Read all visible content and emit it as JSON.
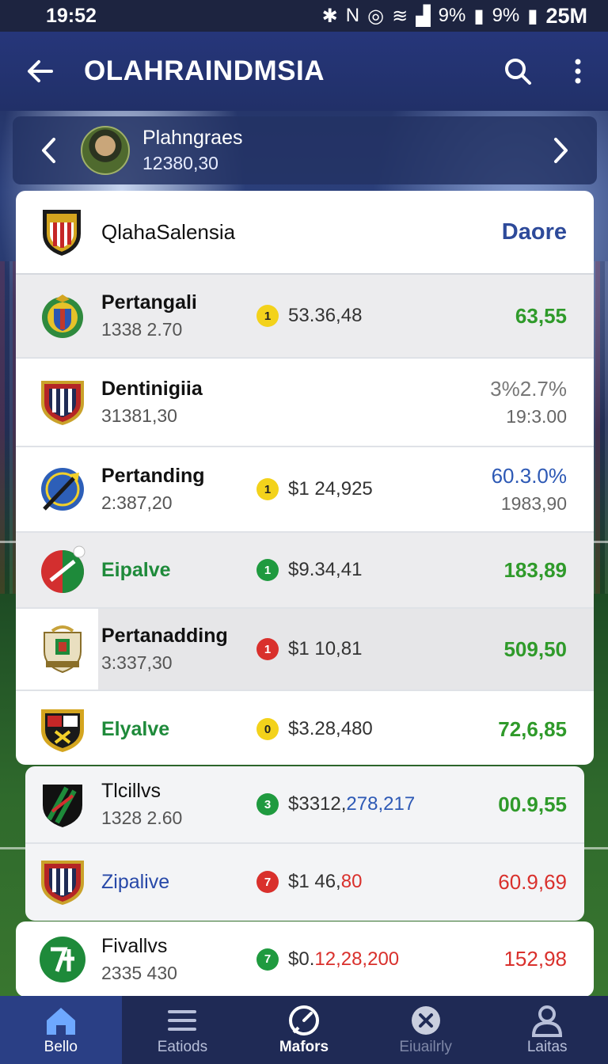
{
  "status": {
    "time": "19:52",
    "battery1": "9%",
    "battery2": "9%",
    "extra": "25M"
  },
  "appbar": {
    "title": "OLAHRAINDMSIA"
  },
  "player": {
    "name": "Plahngraes",
    "value": "12380,30"
  },
  "club": {
    "name": "QlahaSalensia",
    "more_label": "Daore"
  },
  "rows": [
    {
      "name": "Pertangali",
      "sub": "1338 2.70",
      "badge": "1",
      "amount": "53.36,48",
      "right1": "63,55",
      "right2": ""
    },
    {
      "name": "Dentinigiia",
      "sub": "31381,30",
      "badge": "",
      "amount": "",
      "right1": "3%2.7%",
      "right2": "19:3.00"
    },
    {
      "name": "Pertanding",
      "sub": "2:387,20",
      "badge": "1",
      "amount": "$1 24,925",
      "right1": "60.3.0%",
      "right2": "1983,90"
    },
    {
      "name": "Eipalve",
      "sub": "",
      "badge": "1",
      "amount": "$9.34,41",
      "right1": "183,89",
      "right2": ""
    },
    {
      "name": "Pertanadding",
      "sub": "3:337,30",
      "badge": "1",
      "amount": "$1 10,81",
      "right1": "509,50",
      "right2": ""
    },
    {
      "name": "Elyalve",
      "sub": "",
      "badge": "0",
      "amount": "$3.28,480",
      "right1": "72,6,85",
      "right2": ""
    },
    {
      "name": "Tlcillvs",
      "sub": "1328 2.60",
      "badge": "3",
      "amount_a": "$3312,",
      "amount_b": "278,217",
      "right1": "00.9,55",
      "right2": ""
    },
    {
      "name": "Zipalive",
      "sub": "",
      "badge": "7",
      "amount_a": "$1 46,",
      "amount_b": "80",
      "right1": "60.9,69",
      "right2": ""
    },
    {
      "name": "Fivallvs",
      "sub": "2335 430",
      "badge": "7",
      "amount_a": "$0.",
      "amount_b": "12,28,200",
      "right1": "152,98",
      "right2": ""
    }
  ],
  "nav": [
    {
      "label": "Bello",
      "icon": "home-icon"
    },
    {
      "label": "Eatiods",
      "icon": "list-icon"
    },
    {
      "label": "Mafors",
      "icon": "gauge-icon"
    },
    {
      "label": "Eiuailrly",
      "icon": "close-circle-icon"
    },
    {
      "label": "Laitas",
      "icon": "user-icon"
    }
  ],
  "colors": {
    "primary": "#26367a",
    "accent_blue": "#2d4a9a",
    "positive": "#2f9a2a",
    "negative": "#d9302c"
  }
}
